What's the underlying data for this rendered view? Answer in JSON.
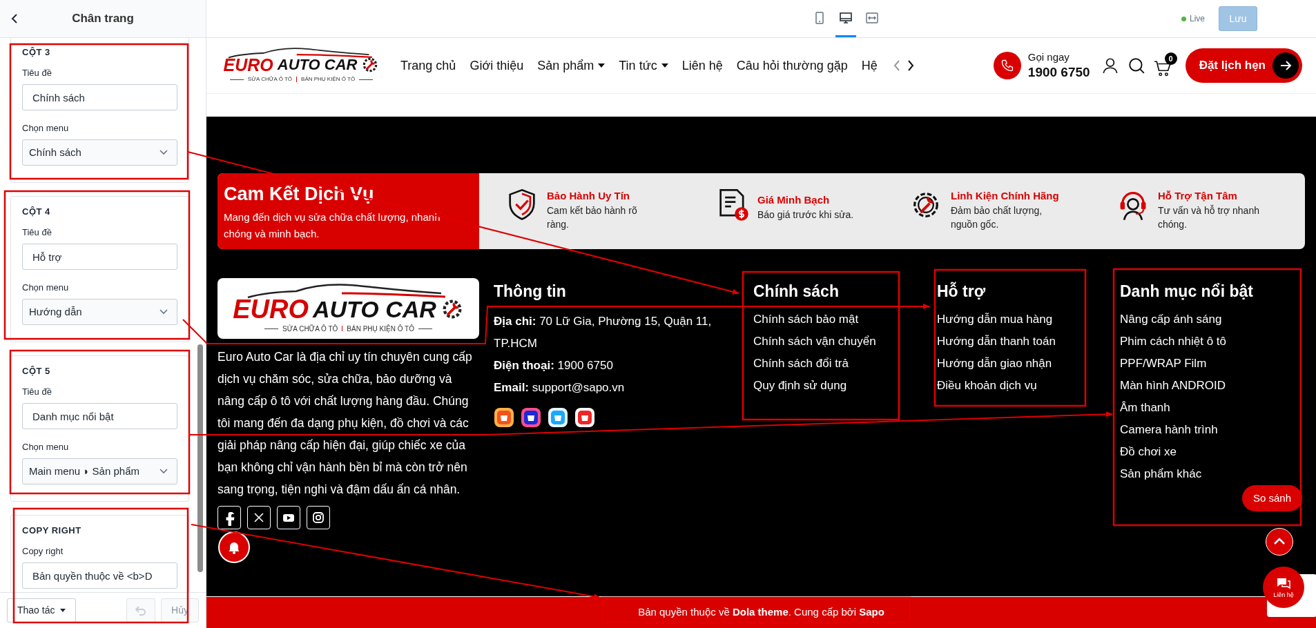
{
  "editor": {
    "title": "Chân trang",
    "sections": [
      {
        "heading": "CỘT 3",
        "fields": [
          {
            "kind": "text",
            "label": "Tiêu đề",
            "value": "Chính sách"
          },
          {
            "kind": "select",
            "label": "Chọn menu",
            "value": "Chính sách"
          }
        ]
      },
      {
        "heading": "CỘT 4",
        "fields": [
          {
            "kind": "text",
            "label": "Tiêu đề",
            "value": "Hỗ trợ"
          },
          {
            "kind": "select",
            "label": "Chọn menu",
            "value": "Hướng dẫn"
          }
        ]
      },
      {
        "heading": "CỘT 5",
        "fields": [
          {
            "kind": "text",
            "label": "Tiêu đề",
            "value": "Danh mục nổi bật"
          },
          {
            "kind": "select",
            "label": "Chọn menu",
            "value": "Main menu ◗ Sản phẩm"
          }
        ]
      },
      {
        "heading": "COPY RIGHT",
        "fields": [
          {
            "kind": "text",
            "label": "Copy right",
            "value": "Bản quyền thuộc về <b>D"
          }
        ]
      }
    ],
    "actions": {
      "label": "Thao tác"
    },
    "undo": {
      "disabled": true
    },
    "cancel": {
      "label": "Hủy",
      "disabled": true
    }
  },
  "toolbar": {
    "devices": [
      {
        "kind": "mobile",
        "selected": false
      },
      {
        "kind": "desktop",
        "selected": true
      },
      {
        "kind": "fullwidth",
        "selected": false
      }
    ],
    "status": "Live",
    "save": {
      "label": "Lưu",
      "disabled": true
    }
  },
  "header": {
    "logo": {
      "brand_1": "EURO",
      "brand_2": "AUTO CAR",
      "tagline_1": "SỬA CHỮA Ô TÔ",
      "tagline_2": "BÁN PHỤ KIỆN Ô TÔ"
    },
    "nav": [
      {
        "label": "Trang chủ",
        "dropdown": false
      },
      {
        "label": "Giới thiệu",
        "dropdown": false
      },
      {
        "label": "Sản phẩm",
        "dropdown": true
      },
      {
        "label": "Tin tức",
        "dropdown": true
      },
      {
        "label": "Liên hệ",
        "dropdown": false
      },
      {
        "label": "Câu hỏi thường gặp",
        "dropdown": false
      },
      {
        "label": "Hệ",
        "dropdown": false
      }
    ],
    "call": {
      "label": "Gọi ngay",
      "phone": "1900 6750"
    },
    "cart_count": "0",
    "booking": "Đặt lịch hẹn"
  },
  "commitment": {
    "title": "Cam Kết Dịch Vụ",
    "text": "Mang đến dịch vụ sửa chữa chất lượng, nhanh chóng và minh bạch.",
    "items": [
      {
        "kind": "shield",
        "title": "Bảo Hành Uy Tín",
        "text": "Cam kết bảo hành rõ ràng."
      },
      {
        "kind": "invoice",
        "title": "Giá Minh Bạch",
        "text": "Báo giá trước khi sửa."
      },
      {
        "kind": "gear",
        "title": "Linh Kiện Chính Hãng",
        "text": "Đảm bảo chất lượng, nguồn gốc."
      },
      {
        "kind": "headset",
        "title": "Hỗ Trợ Tận Tâm",
        "text": "Tư vấn và hỗ trợ nhanh chóng."
      }
    ]
  },
  "footer": {
    "logo": {
      "brand_1": "EURO",
      "brand_2": "AUTO CAR",
      "tagline_1": "SỬA CHỮA Ô TÔ",
      "tagline_2": "BÁN PHỤ KIỆN Ô TÔ"
    },
    "about": "Euro Auto Car là địa chỉ uy tín chuyên cung cấp dịch vụ chăm sóc, sửa chữa, bảo dưỡng và nâng cấp ô tô với chất lượng hàng đầu. Chúng tôi mang đến đa dạng phụ kiện, đồ chơi và các giải pháp nâng cấp hiện đại, giúp chiếc xe của bạn không chỉ vận hành bền bỉ mà còn trở nên sang trọng, tiện nghi và đậm dấu ấn cá nhân.",
    "info": {
      "title": "Thông tin",
      "lines": [
        "**Địa chỉ:** 70 Lữ Gia, Phường 15, Quận 11, TP.HCM",
        "**Điện thoại:** 1900 6750",
        "**Email:** support@sapo.vn"
      ]
    },
    "columns": [
      {
        "title": "Chính sách",
        "links": [
          "Chính sách bảo mật",
          "Chính sách vận chuyển",
          "Chính sách đổi trả",
          "Quy định sử dụng"
        ]
      },
      {
        "title": "Hỗ trợ",
        "links": [
          "Hướng dẫn mua hàng",
          "Hướng dẫn thanh toán",
          "Hướng dẫn giao nhận",
          "Điều khoản dịch vụ"
        ]
      },
      {
        "title": "Danh mục nổi bật",
        "links": [
          "Nâng cấp ánh sáng",
          "Phim cách nhiệt ô tô",
          "PPF/WRAP Film",
          "Màn hình ANDROID",
          "Âm thanh",
          "Camera hành trình",
          "Đồ chơi xe",
          "Sản phẩm khác"
        ]
      }
    ],
    "copyright": "Bản quyền thuộc về **Dola theme**. Cung cấp bởi **Sapo**"
  },
  "floating": {
    "compare": "So sánh",
    "contact": "Liên hệ"
  }
}
